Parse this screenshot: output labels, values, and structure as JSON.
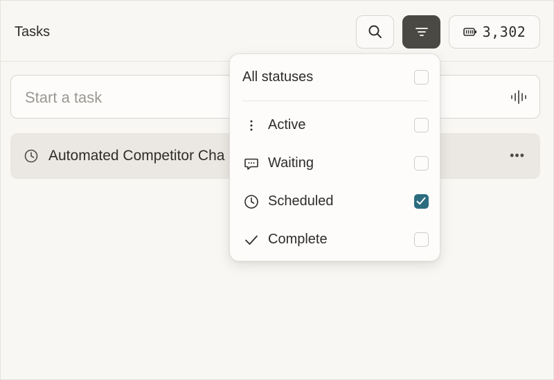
{
  "header": {
    "title": "Tasks",
    "credits": "3,302"
  },
  "composer": {
    "placeholder": "Start a task"
  },
  "tasks": [
    {
      "name": "Automated Competitor Cha",
      "status_icon": "clock-icon"
    }
  ],
  "filter_menu": {
    "all_label": "All statuses",
    "options": [
      {
        "label": "Active",
        "icon": "vertical-dots-icon",
        "checked": false
      },
      {
        "label": "Waiting",
        "icon": "chat-bubble-icon",
        "checked": false
      },
      {
        "label": "Scheduled",
        "icon": "clock-icon",
        "checked": true
      },
      {
        "label": "Complete",
        "icon": "checkmark-icon",
        "checked": false
      }
    ],
    "all_checked": false
  },
  "colors": {
    "accent": "#2b6d7f",
    "filter_button": "#4a4943",
    "background": "#f8f7f4"
  }
}
